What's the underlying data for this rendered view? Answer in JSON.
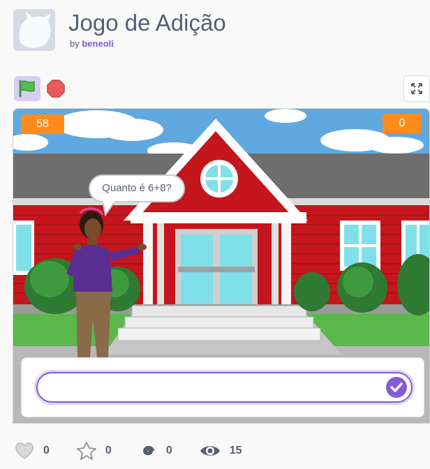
{
  "project": {
    "title": "Jogo de Adição",
    "by_label": "by",
    "author": "beneoli"
  },
  "controls": {
    "green_flag_icon": "green-flag-icon",
    "stop_icon": "stop-sign-icon",
    "fullscreen_icon": "fullscreen-icon"
  },
  "stage": {
    "timer_value": "58",
    "score_value": "0",
    "speech_bubble": "Quanto é 6+8?",
    "answer_input_value": "",
    "submit_icon": "check-icon"
  },
  "stats": {
    "loves": "0",
    "favorites": "0",
    "remixes": "0",
    "views": "15"
  },
  "colors": {
    "accent": "#855cd6",
    "variable_monitor": "#ff8c1a",
    "green_flag": "#4cbf56",
    "stop": "#ec5959"
  }
}
